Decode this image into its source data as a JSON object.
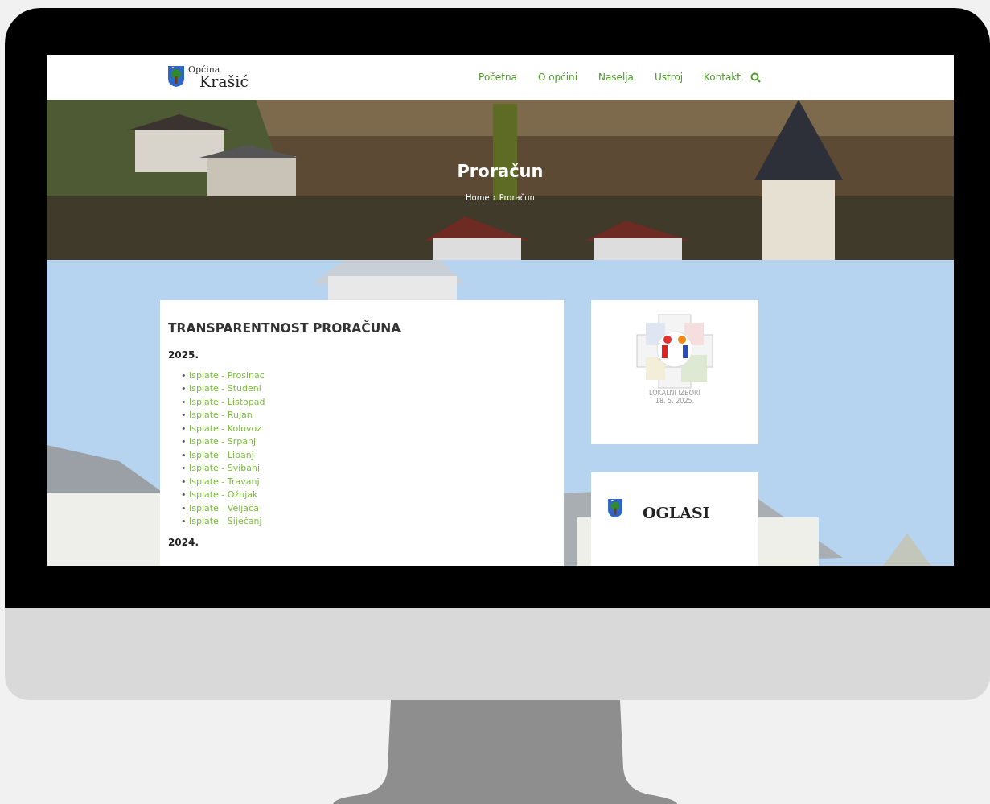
{
  "logo": {
    "line_1": "Općina",
    "line_2": "Krašić"
  },
  "nav": [
    {
      "label": "Početna"
    },
    {
      "label": "O općini"
    },
    {
      "label": "Naselja"
    },
    {
      "label": "Ustroj"
    },
    {
      "label": "Kontakt"
    }
  ],
  "hero": {
    "title": "Proračun",
    "breadcrumb": [
      {
        "label": "Home"
      },
      {
        "label": "Proračun"
      }
    ],
    "separator": "›"
  },
  "main": {
    "title": "TRANSPARENTNOST PRORAČUNA",
    "bullet": "•",
    "sections": [
      {
        "year": "2025.",
        "links": [
          "Isplate - Prosinac",
          "Isplate - Studeni",
          "Isplate - Listopad",
          "Isplate - Rujan",
          "Isplate - Kolovoz",
          "Isplate - Srpanj",
          "Isplate - Lipanj",
          "Isplate - Svibanj",
          "Isplate - Travanj",
          "Isplate - Ožujak",
          "Isplate - Veljača",
          "Isplate - Siječanj"
        ]
      },
      {
        "year": "2024."
      }
    ]
  },
  "sidebar": [
    {
      "kind": "election",
      "caption": [
        "LOKALNI IZBORI",
        "18. 5. 2025."
      ]
    },
    {
      "kind": "notices",
      "title": "OGLASI"
    }
  ]
}
